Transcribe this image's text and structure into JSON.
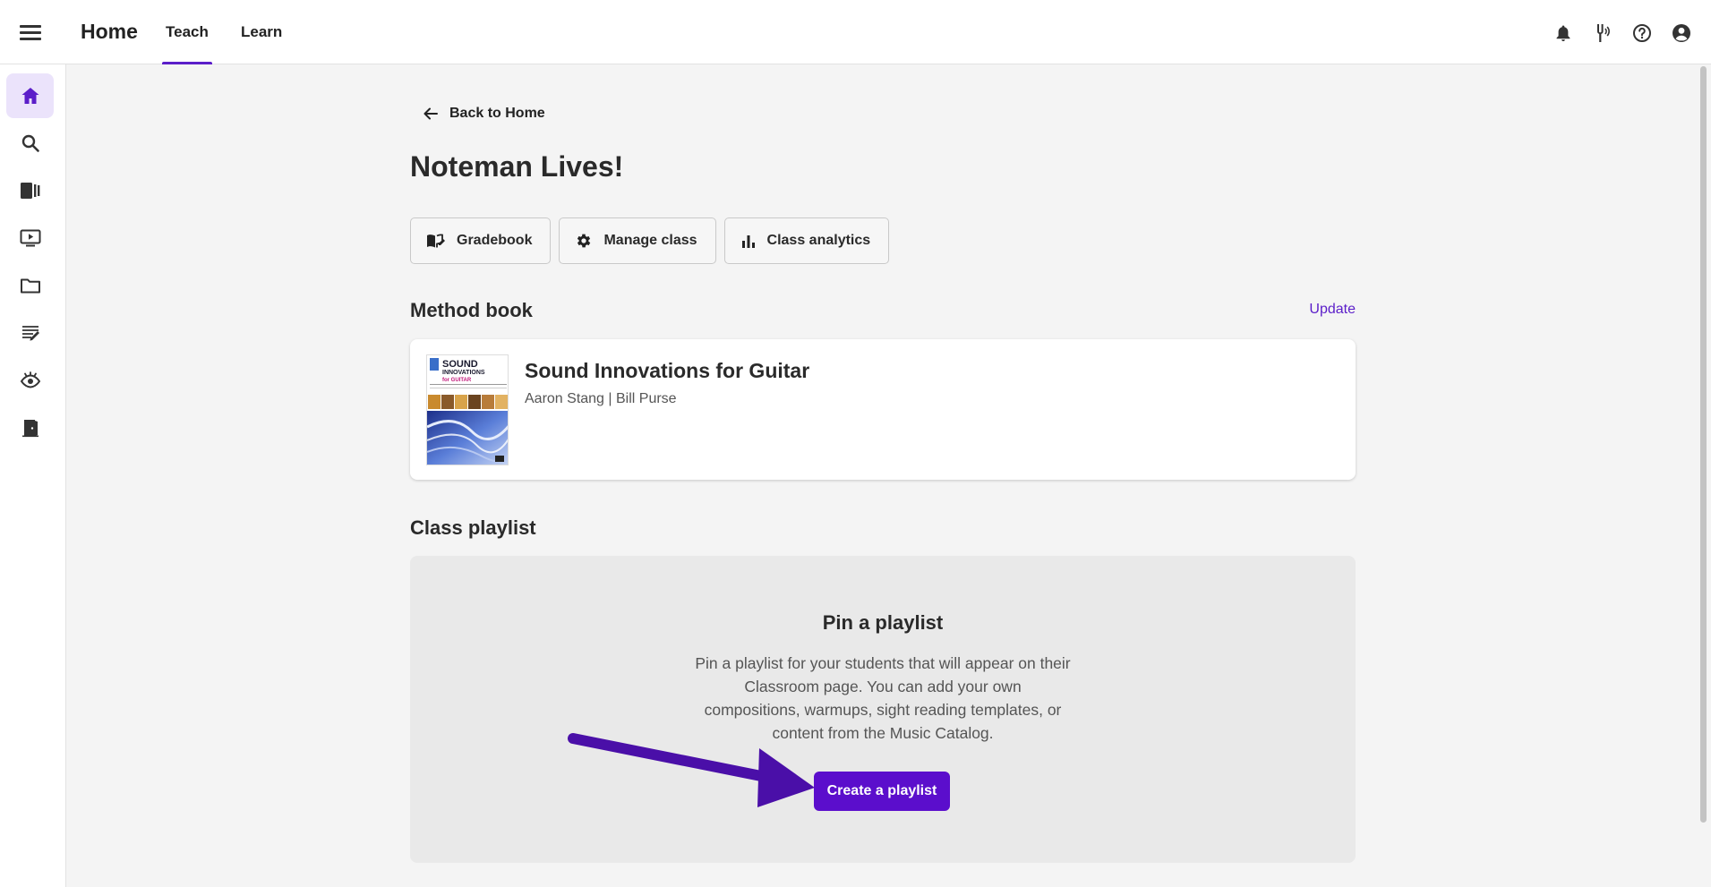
{
  "header": {
    "app_title": "Home",
    "tabs": [
      {
        "label": "Teach",
        "active": true
      },
      {
        "label": "Learn",
        "active": false
      }
    ],
    "icons": [
      "bell-icon",
      "tuning-fork-icon",
      "help-icon",
      "account-icon"
    ]
  },
  "sidebar": {
    "items": [
      {
        "name": "home",
        "icon": "home-icon",
        "active": true
      },
      {
        "name": "search",
        "icon": "search-icon"
      },
      {
        "name": "library",
        "icon": "library-icon"
      },
      {
        "name": "video",
        "icon": "video-icon"
      },
      {
        "name": "folder",
        "icon": "folder-icon"
      },
      {
        "name": "sight-reading",
        "icon": "sight-reading-icon"
      },
      {
        "name": "ear-training",
        "icon": "ear-icon"
      },
      {
        "name": "classroom",
        "icon": "door-icon"
      }
    ]
  },
  "main": {
    "back_label": "Back to Home",
    "title": "Noteman Lives!",
    "actions": {
      "gradebook": "Gradebook",
      "manage_class": "Manage class",
      "class_analytics": "Class analytics"
    },
    "method_book": {
      "section_title": "Method book",
      "update_label": "Update",
      "book_title": "Sound Innovations for Guitar",
      "authors": "Aaron Stang | Bill Purse",
      "cover": {
        "line1": "SOUND",
        "line2": "INNOVATIONS",
        "line3": "for GUITAR"
      }
    },
    "class_playlist": {
      "section_title": "Class playlist",
      "pin_title": "Pin a playlist",
      "pin_description": "Pin a playlist for your students that will appear on their Classroom page. You can add your own compositions, warmups, sight reading templates, or content from the Music Catalog.",
      "create_label": "Create a playlist"
    }
  },
  "colors": {
    "accent": "#5b1ec9",
    "button_primary": "#5b0ecc",
    "annotation_arrow": "#4a0fa8"
  }
}
